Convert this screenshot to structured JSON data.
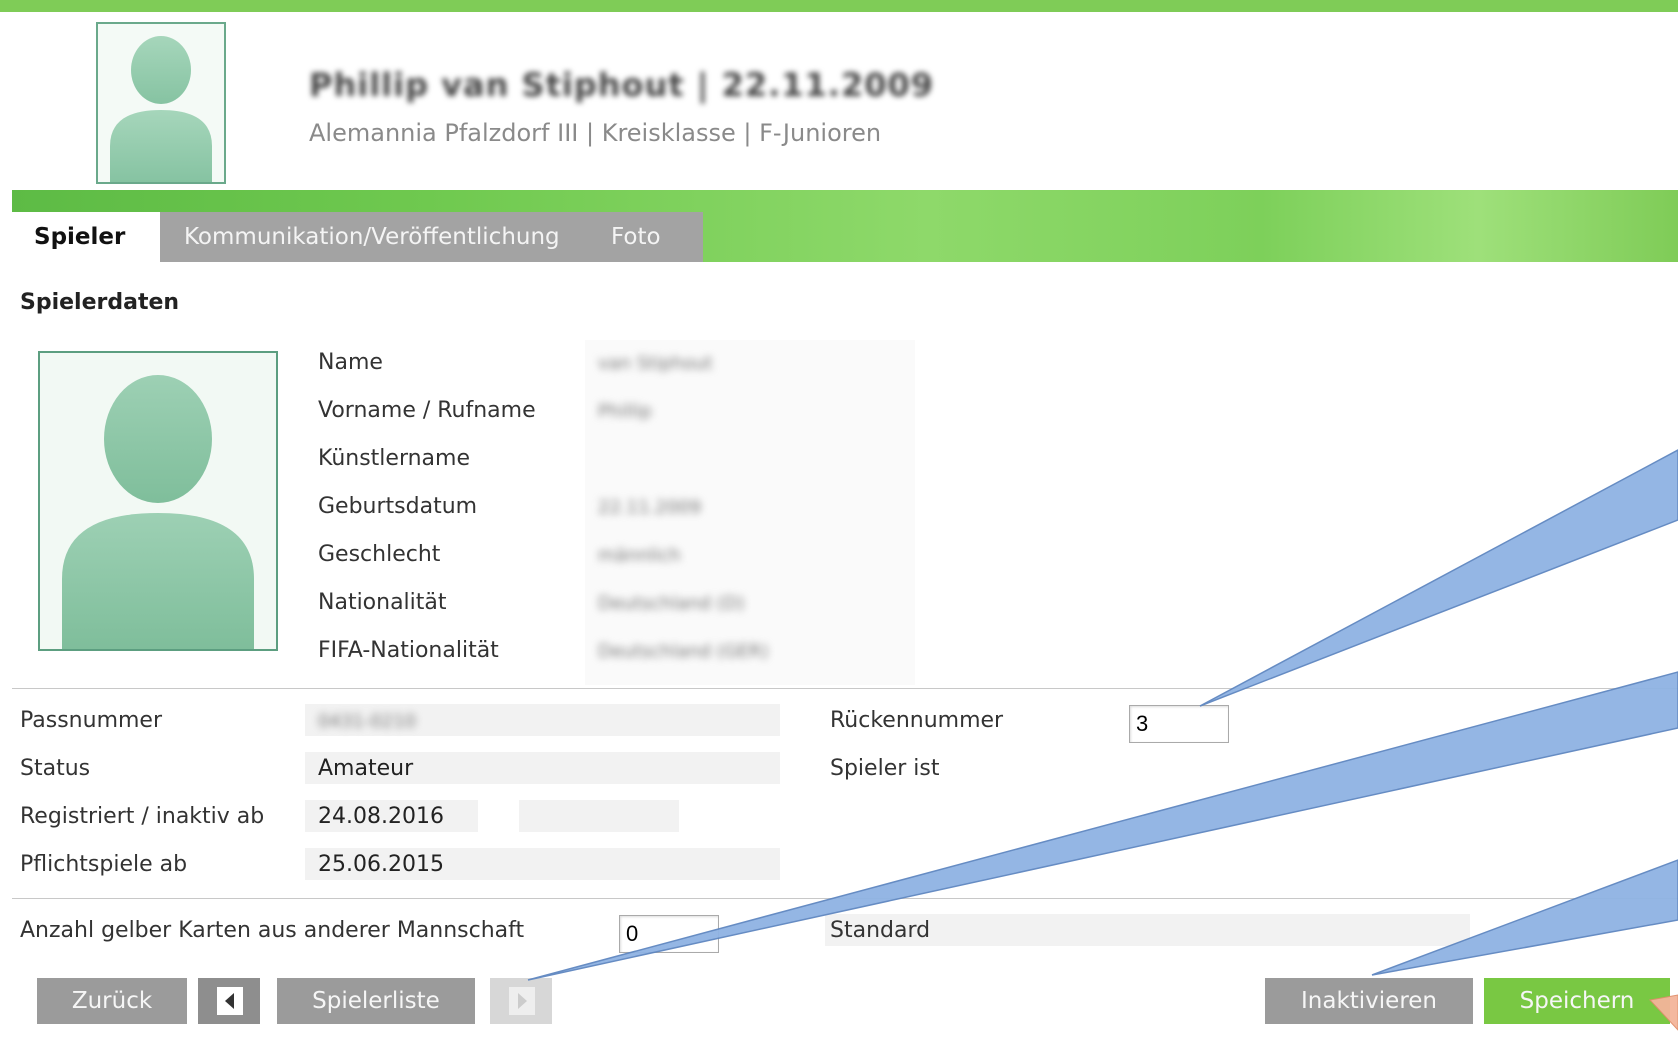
{
  "header": {
    "player_title": "Phillip van Stiphout | 22.11.2009",
    "player_subtitle": "Alemannia Pfalzdorf III | Kreisklasse | F-Junioren"
  },
  "tabs": [
    {
      "label": "Spieler"
    },
    {
      "label": "Kommunikation/Veröffentlichung"
    },
    {
      "label": "Foto"
    }
  ],
  "section": {
    "title": "Spielerdaten"
  },
  "fields": {
    "name": {
      "label": "Name",
      "value": "van Stiphout"
    },
    "vorname": {
      "label": "Vorname / Rufname",
      "value": "Phillip"
    },
    "kuenstlername": {
      "label": "Künstlername",
      "value": ""
    },
    "geburtsdatum": {
      "label": "Geburtsdatum",
      "value": "22.11.2009"
    },
    "geschlecht": {
      "label": "Geschlecht",
      "value": "männlich"
    },
    "nationalitaet": {
      "label": "Nationalität",
      "value": "Deutschland (D)"
    },
    "fifa_nationalitaet": {
      "label": "FIFA-Nationalität",
      "value": "Deutschland (GER)"
    }
  },
  "details": {
    "passnummer": {
      "label": "Passnummer",
      "value": "0431-0210"
    },
    "status": {
      "label": "Status",
      "value": "Amateur"
    },
    "registriert": {
      "label": "Registriert / inaktiv ab",
      "value": "24.08.2016",
      "inaktiv_value": ""
    },
    "pflichtspiele": {
      "label": "Pflichtspiele ab",
      "value": "25.06.2015"
    },
    "rueckennummer": {
      "label": "Rückennummer",
      "value": "3"
    },
    "spieler_ist": {
      "label": "Spieler ist",
      "value": ""
    }
  },
  "cards": {
    "label": "Anzahl gelber Karten aus anderer Mannschaft",
    "value": "0",
    "standard_label": "Standard"
  },
  "buttons": {
    "zurueck": "Zurück",
    "spielerliste": "Spielerliste",
    "inaktivieren": "Inaktivieren",
    "speichern": "Speichern"
  },
  "icons": {
    "prev": "prev-arrow-icon",
    "next": "next-arrow-icon",
    "avatar": "person-silhouette-icon"
  },
  "colors": {
    "accent_green": "#79c843",
    "band_green": "#6fc94f",
    "tab_gray": "#a3a3a3",
    "callout_blue": "#8fb3e3"
  }
}
